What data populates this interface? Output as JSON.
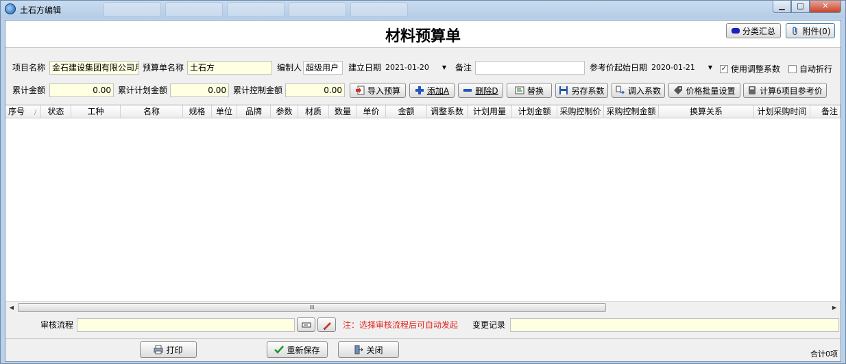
{
  "window": {
    "title": "土石方编辑",
    "min": "▁",
    "max": "□",
    "close": "✕"
  },
  "header": {
    "title": "材料预算单",
    "summary_btn": "分类汇总",
    "attach_btn": "附件(0)"
  },
  "form": {
    "project_label": "项目名称",
    "project_value": "金石建设集团有限公司月",
    "budget_name_label": "预算单名称",
    "budget_name_value": "土石方",
    "editor_label": "编制人",
    "editor_value": "超级用户",
    "created_label": "建立日期",
    "created_value": "2021-01-20",
    "remark_label": "备注",
    "remark_value": "",
    "ref_date_label": "参考价起始日期",
    "ref_date_value": "2020-01-21",
    "use_coef_label": "使用调整系数",
    "use_coef_checked": "✓",
    "auto_discount_label": "自动折行",
    "total_label": "累计金额",
    "total_value": "0.00",
    "plan_total_label": "累计计划金额",
    "plan_total_value": "0.00",
    "ctrl_total_label": "累计控制金额",
    "ctrl_total_value": "0.00"
  },
  "toolbar": {
    "import": "导入预算",
    "add": "添加A",
    "delete": "删除D",
    "replace": "替换",
    "save_coef": "另存系数",
    "load_coef": "调入系数",
    "batch_price": "价格批量设置",
    "calc_ref": "计算6项目参考价"
  },
  "table": {
    "columns": [
      "序号",
      "状态",
      "工种",
      "名称",
      "规格",
      "单位",
      "品牌",
      "参数",
      "材质",
      "数量",
      "单价",
      "金额",
      "调整系数",
      "计划用量",
      "计划金额",
      "采购控制价",
      "采购控制金额",
      "换算关系",
      "计划采购时间",
      "备注"
    ],
    "sort_mark": "/",
    "scroll_grip": "III"
  },
  "bottom": {
    "flow_label": "审核流程",
    "flow_value": "",
    "note": "注：选择审核流程后可自动发起",
    "change_label": "变更记录",
    "change_value": "",
    "print": "打印",
    "resave": "重新保存",
    "close": "关闭",
    "count": "合计0项"
  },
  "colors": {
    "note_red": "#e0241b",
    "yellow_field": "#ffffe1"
  }
}
